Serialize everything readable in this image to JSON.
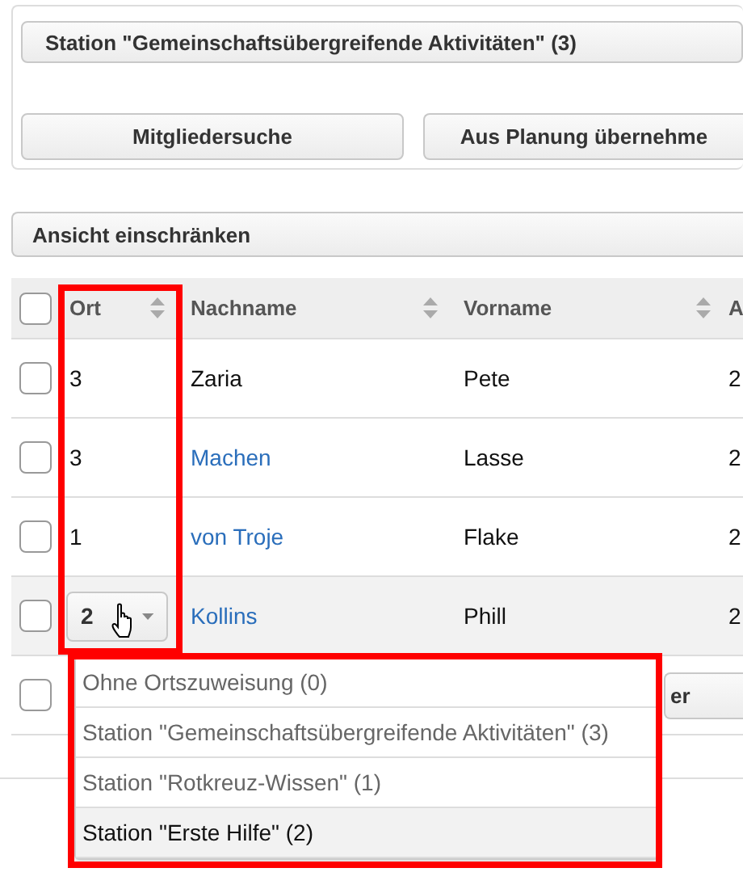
{
  "panel": {
    "title": "Station \"Gemeinschaftsübergreifende Aktivitäten\" (3)",
    "buttons": [
      "Mitgliedersuche",
      "Aus Planung übernehme"
    ]
  },
  "filter_bar": {
    "label": "Ansicht einschränken"
  },
  "table": {
    "header_checked": false,
    "columns": [
      {
        "label": "Ort",
        "sortable": true
      },
      {
        "label": "Nachname",
        "sortable": true
      },
      {
        "label": "Vorname",
        "sortable": true
      },
      {
        "label": "A"
      }
    ],
    "rows": [
      {
        "kind": "text",
        "checked": false,
        "hovered": false,
        "ort": "3",
        "nachname": "Zaria",
        "link": false,
        "vorname": "Pete",
        "column_4": "2"
      },
      {
        "kind": "text",
        "checked": false,
        "hovered": false,
        "ort": "3",
        "nachname": "Machen",
        "link": true,
        "vorname": "Lasse",
        "column_4": "2"
      },
      {
        "kind": "text",
        "checked": false,
        "hovered": false,
        "ort": "1",
        "nachname": "von Troje",
        "link": true,
        "vorname": "Flake",
        "column_4": "2"
      },
      {
        "kind": "select",
        "checked": false,
        "hovered": true,
        "ort": "2",
        "nachname": "Kollins",
        "link": true,
        "vorname": "Phill",
        "column_4": "2"
      },
      {
        "kind": "action",
        "checked": false,
        "hovered": false,
        "button": "er"
      }
    ]
  },
  "dropdown": {
    "options": [
      {
        "label": "Ohne Ortszuweisung (0)",
        "selected": false
      },
      {
        "label": "Station \"Gemeinschaftsübergreifende Aktivitäten\" (3)",
        "selected": false
      },
      {
        "label": "Station \"Rotkreuz-Wissen\" (1)",
        "selected": false
      },
      {
        "label": "Station \"Erste Hilfe\" (2)",
        "selected": true
      }
    ]
  },
  "highlights": {
    "ort_column": true,
    "menu": true
  }
}
